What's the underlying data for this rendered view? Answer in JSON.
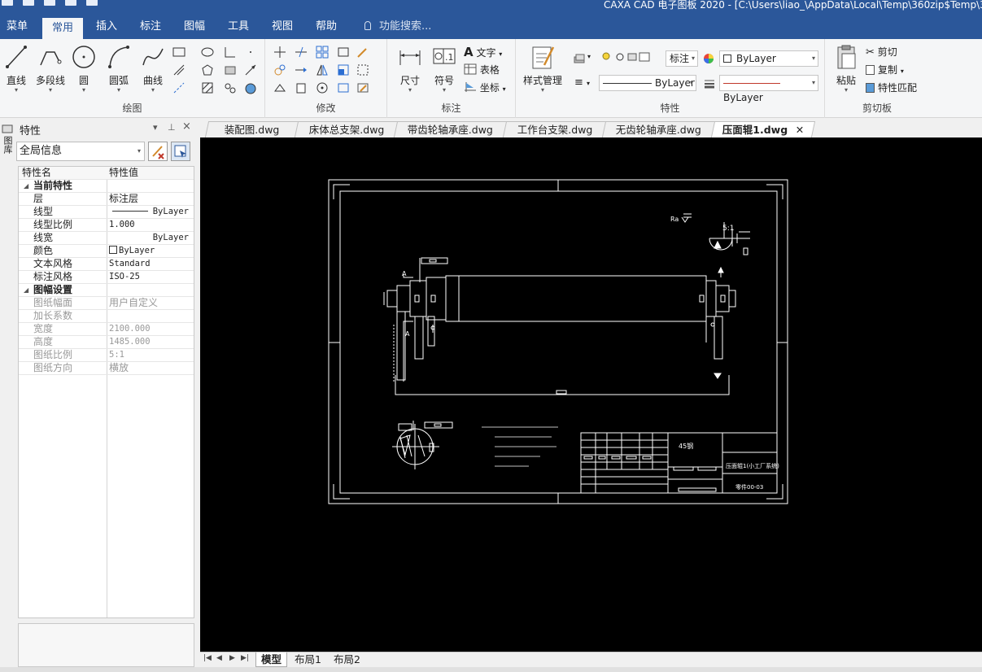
{
  "window": {
    "title": "CAXA CAD 电子图板 2020 - [C:\\Users\\liao_\\AppData\\Local\\Temp\\360zip$Temp\\360$12\\"
  },
  "menu": {
    "tabs": [
      "菜单",
      "常用",
      "插入",
      "标注",
      "图幅",
      "工具",
      "视图",
      "帮助"
    ],
    "active": "常用",
    "search": "功能搜索..."
  },
  "ribbon": {
    "draw": {
      "label": "绘图",
      "buttons": [
        "直线",
        "多段线",
        "圆",
        "圆弧",
        "曲线"
      ]
    },
    "modify": {
      "label": "修改"
    },
    "annotate": {
      "label": "标注",
      "buttons": [
        "尺寸",
        "符号"
      ],
      "small": [
        "文字",
        "表格",
        "坐标"
      ]
    },
    "properties": {
      "label": "特性",
      "style_button": "样式管理",
      "layer_combo": "标注",
      "color_combo": "ByLayer",
      "linetype_combo": "ByLayer",
      "lineweight_combo": "ByLayer"
    },
    "clipboard": {
      "label": "剪切板",
      "paste": "粘贴",
      "small": [
        "剪切",
        "复制",
        "特性匹配"
      ]
    }
  },
  "properties_panel": {
    "title": "特性",
    "side_tab": "图库",
    "filter": "全局信息",
    "header": {
      "name": "特性名",
      "value": "特性值"
    },
    "rows": [
      {
        "type": "section",
        "name": "当前特性"
      },
      {
        "name": "层",
        "value": "标注层"
      },
      {
        "name": "线型",
        "value": "ByLayer"
      },
      {
        "name": "线型比例",
        "value": "1.000"
      },
      {
        "name": "线宽",
        "value": "ByLayer"
      },
      {
        "name": "颜色",
        "value": "ByLayer"
      },
      {
        "name": "文本风格",
        "value": "Standard"
      },
      {
        "name": "标注风格",
        "value": "ISO-25"
      },
      {
        "type": "section",
        "name": "图幅设置"
      },
      {
        "name": "图纸幅面",
        "value": "用户自定义",
        "grey": true
      },
      {
        "name": "加长系数",
        "value": "",
        "grey": true
      },
      {
        "name": "宽度",
        "value": "2100.000",
        "grey": true
      },
      {
        "name": "高度",
        "value": "1485.000",
        "grey": true
      },
      {
        "name": "图纸比例",
        "value": "5:1",
        "grey": true
      },
      {
        "name": "图纸方向",
        "value": "横放",
        "grey": true
      }
    ]
  },
  "document_tabs": [
    "装配图.dwg",
    "床体总支架.dwg",
    "带齿轮轴承座.dwg",
    "工作台支架.dwg",
    "无齿轮轴承座.dwg",
    "压面辊1.dwg"
  ],
  "active_document": "压面辊1.dwg",
  "drawing": {
    "scale_note": "5:1",
    "title_block_name": "压面辊1(小工厂系统)",
    "title_block_code": "零件00-03",
    "material": "45钢",
    "section_labels": [
      "A",
      "A"
    ]
  },
  "layout_tabs": [
    "模型",
    "布局1",
    "布局2"
  ],
  "active_layout": "模型",
  "colors": {
    "accent": "#2b579a",
    "canvas": "#000000",
    "ribbon": "#f5f6f7"
  }
}
